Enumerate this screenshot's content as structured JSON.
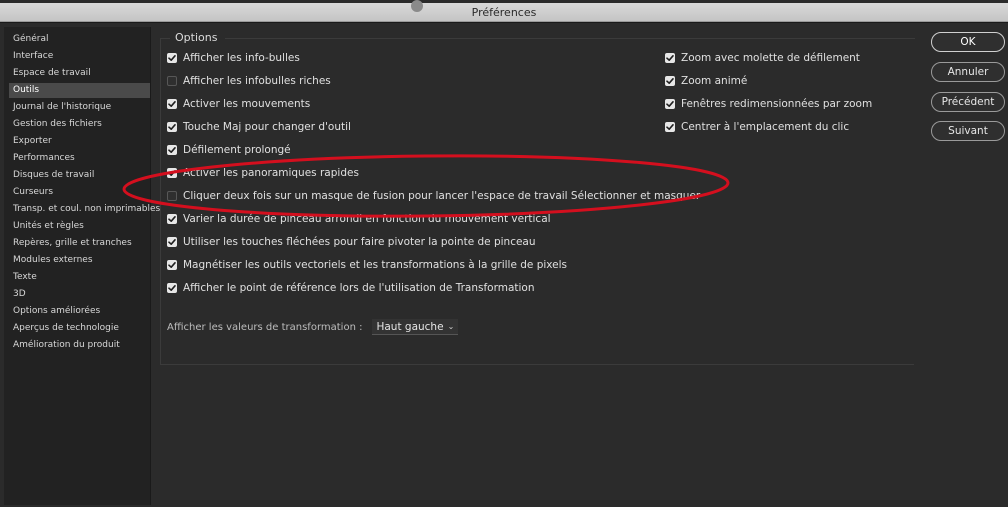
{
  "window": {
    "title": "Préférences"
  },
  "sidebar": {
    "items": [
      {
        "label": "Général"
      },
      {
        "label": "Interface"
      },
      {
        "label": "Espace de travail"
      },
      {
        "label": "Outils",
        "selected": true
      },
      {
        "label": "Journal de l'historique"
      },
      {
        "label": "Gestion des fichiers"
      },
      {
        "label": "Exporter"
      },
      {
        "label": "Performances"
      },
      {
        "label": "Disques de travail"
      },
      {
        "label": "Curseurs"
      },
      {
        "label": "Transp. et coul. non imprimables"
      },
      {
        "label": "Unités et règles"
      },
      {
        "label": "Repères, grille et tranches"
      },
      {
        "label": "Modules externes"
      },
      {
        "label": "Texte"
      },
      {
        "label": "3D"
      },
      {
        "label": "Options améliorées"
      },
      {
        "label": "Aperçus de technologie"
      },
      {
        "label": "Amélioration du produit"
      }
    ]
  },
  "options": {
    "title": "Options",
    "left": [
      {
        "label": "Afficher les info-bulles",
        "checked": true
      },
      {
        "label": "Afficher les infobulles riches",
        "checked": false
      },
      {
        "label": "Activer les mouvements",
        "checked": true
      },
      {
        "label": "Touche Maj pour changer d'outil",
        "checked": true
      },
      {
        "label": "Défilement prolongé",
        "checked": true
      },
      {
        "label": "Activer les panoramiques rapides",
        "checked": true
      },
      {
        "label": "Cliquer deux fois sur un masque de fusion pour lancer l'espace de travail Sélectionner et masquer",
        "checked": false
      },
      {
        "label": "Varier la durée de pinceau arrondi en fonction du mouvement vertical",
        "checked": true
      },
      {
        "label": "Utiliser les touches fléchées pour faire pivoter la pointe de pinceau",
        "checked": true
      },
      {
        "label": "Magnétiser les outils vectoriels et les transformations à la grille de pixels",
        "checked": true
      },
      {
        "label": "Afficher le point de référence lors de l'utilisation de Transformation",
        "checked": true
      }
    ],
    "right": [
      {
        "label": "Zoom avec molette de défilement",
        "checked": true
      },
      {
        "label": "Zoom animé",
        "checked": true
      },
      {
        "label": "Fenêtres redimensionnées par zoom",
        "checked": true
      },
      {
        "label": "Centrer à l'emplacement du clic",
        "checked": true
      }
    ],
    "transform": {
      "label": "Afficher les valeurs de transformation :",
      "value": "Haut gauche"
    }
  },
  "buttons": {
    "ok": "OK",
    "cancel": "Annuler",
    "previous": "Précédent",
    "next": "Suivant"
  },
  "colors": {
    "annotation": "#d40f1e",
    "checkbox_on": "#e6e6e6",
    "window_bg": "#2b2b2b",
    "sidebar_selected": "#4a4a4a"
  }
}
